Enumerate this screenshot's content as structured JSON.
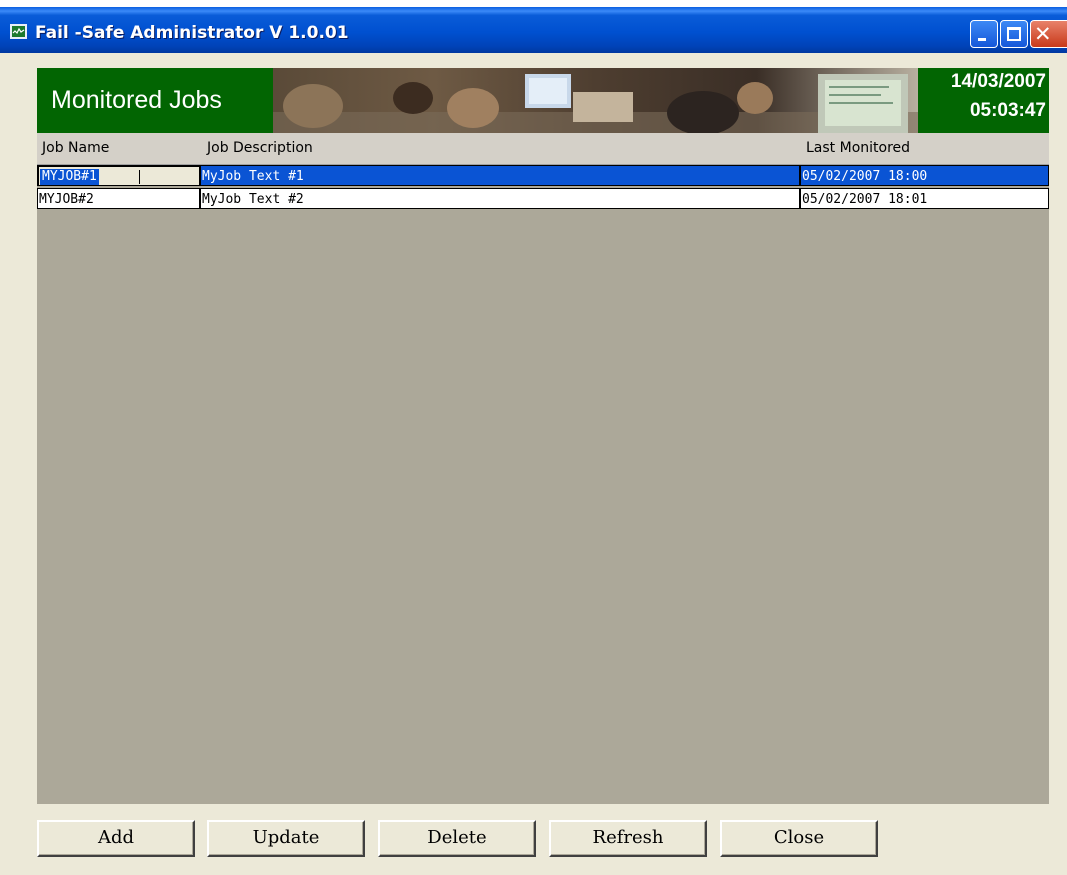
{
  "window": {
    "title": "Fail -Safe Administrator V 1.0.01",
    "controls": {
      "minimize_icon": "minimize-icon",
      "maximize_icon": "maximize-icon",
      "close_icon": "close-icon",
      "close_glyph": "✕"
    }
  },
  "banner": {
    "title": "Monitored Jobs",
    "date": "14/03/2007",
    "time": "05:03:47",
    "photo_icon": "office-photo"
  },
  "grid": {
    "columns": [
      "Job Name",
      "Job Description",
      "Last Monitored"
    ],
    "rows": [
      {
        "name": "MYJOB#1",
        "description": "MyJob Text #1",
        "last_monitored": "05/02/2007 18:00",
        "selected": true,
        "editing": true
      },
      {
        "name": "MYJOB#2",
        "description": "MyJob Text #2",
        "last_monitored": "05/02/2007 18:01",
        "selected": false,
        "editing": false
      }
    ]
  },
  "buttons": {
    "add": "Add",
    "update": "Update",
    "delete": "Delete",
    "refresh": "Refresh",
    "close": "Close"
  },
  "colors": {
    "titlebar": "#0054e3",
    "banner_green": "#026502",
    "selection": "#0a54d4",
    "grid_bg": "#aca899",
    "face": "#ece9d8"
  }
}
